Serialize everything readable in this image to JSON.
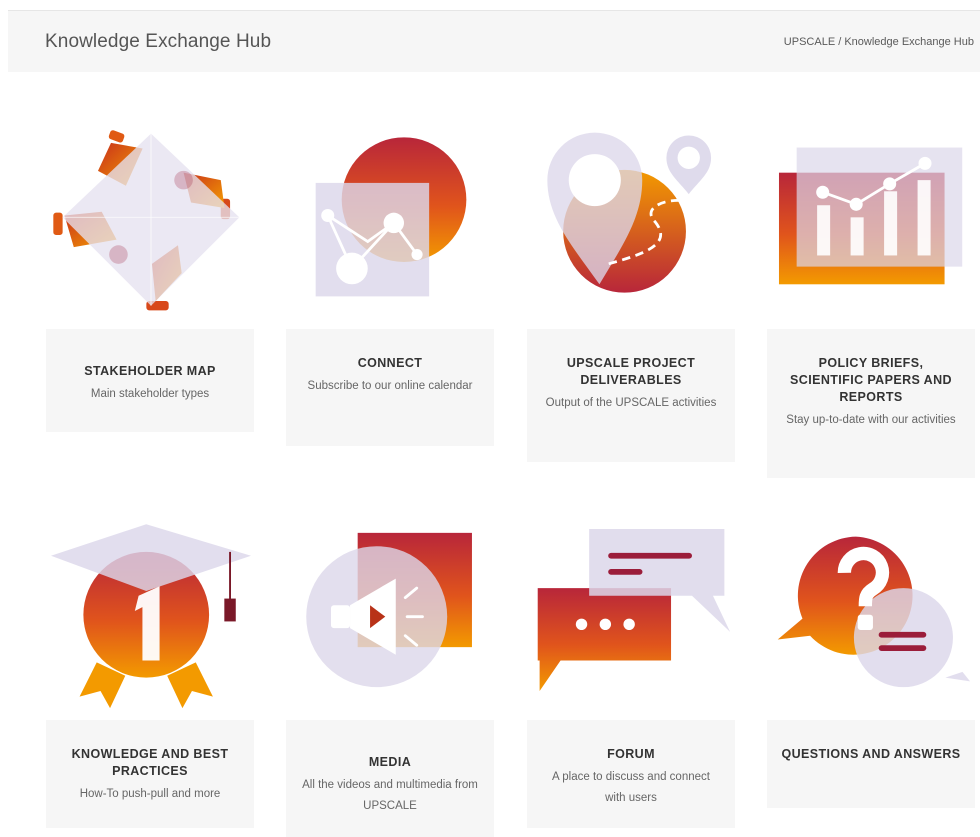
{
  "header": {
    "title": "Knowledge Exchange Hub"
  },
  "breadcrumb": {
    "home": "UPSCALE",
    "separator": "/",
    "current": "Knowledge Exchange Hub"
  },
  "colors": {
    "orange": "#f08a00",
    "crimson": "#9b1d3a",
    "glass": "#dcd7ea",
    "card_bg": "#f6f6f6"
  },
  "tiles": [
    {
      "icon": "handshake-diamond-icon",
      "title": "STAKEHOLDER MAP",
      "subtitle": "Main stakeholder types"
    },
    {
      "icon": "network-nodes-icon",
      "title": "CONNECT",
      "subtitle": "Subscribe to our online calendar"
    },
    {
      "icon": "map-pin-route-icon",
      "title": "UPSCALE PROJECT DELIVERABLES",
      "subtitle": "Output of the UPSCALE activities"
    },
    {
      "icon": "bar-line-chart-icon",
      "title": "POLICY BRIEFS, SCIENTIFIC PAPERS AND REPORTS",
      "subtitle": "Stay up-to-date with our activities"
    },
    {
      "icon": "graduation-medal-icon",
      "title": "KNOWLEDGE AND BEST PRACTICES",
      "subtitle": "How-To push-pull and more"
    },
    {
      "icon": "megaphone-icon",
      "title": "MEDIA",
      "subtitle": "All the videos and multimedia from UPSCALE"
    },
    {
      "icon": "chat-bubbles-icon",
      "title": "FORUM",
      "subtitle": "A place to discuss and connect with users"
    },
    {
      "icon": "question-bubble-icon",
      "title": "QUESTIONS AND ANSWERS",
      "subtitle": ""
    }
  ]
}
